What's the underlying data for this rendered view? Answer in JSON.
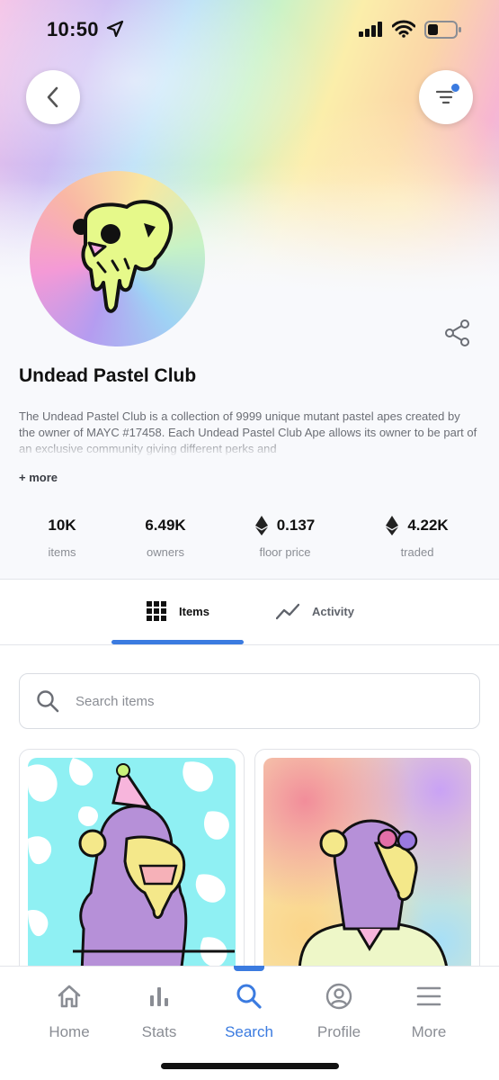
{
  "status_bar": {
    "time": "10:50"
  },
  "collection": {
    "name": "Undead Pastel Club",
    "description": "The Undead Pastel Club is a collection of 9999 unique mutant pastel apes created by the owner of MAYC #17458.  Each Undead Pastel Club Ape allows its owner to be part of an exclusive community giving different perks and",
    "more_label": "+ more"
  },
  "stats": [
    {
      "value": "10K",
      "label": "items",
      "eth": false
    },
    {
      "value": "6.49K",
      "label": "owners",
      "eth": false
    },
    {
      "value": "0.137",
      "label": "floor price",
      "eth": true
    },
    {
      "value": "4.22K",
      "label": "traded",
      "eth": true
    }
  ],
  "tabs": [
    {
      "label": "Items",
      "icon": "grid-icon",
      "active": true
    },
    {
      "label": "Activity",
      "icon": "trend-line-icon",
      "active": false
    }
  ],
  "search": {
    "placeholder": "Search items",
    "value": ""
  },
  "bottom_nav": [
    {
      "label": "Home",
      "icon": "home-icon"
    },
    {
      "label": "Stats",
      "icon": "bar-chart-icon"
    },
    {
      "label": "Search",
      "icon": "search-icon",
      "active": true
    },
    {
      "label": "Profile",
      "icon": "profile-icon"
    },
    {
      "label": "More",
      "icon": "menu-icon"
    }
  ],
  "colors": {
    "accent": "#3b7be0",
    "text_primary": "#111111",
    "text_muted": "#8a8d94"
  }
}
